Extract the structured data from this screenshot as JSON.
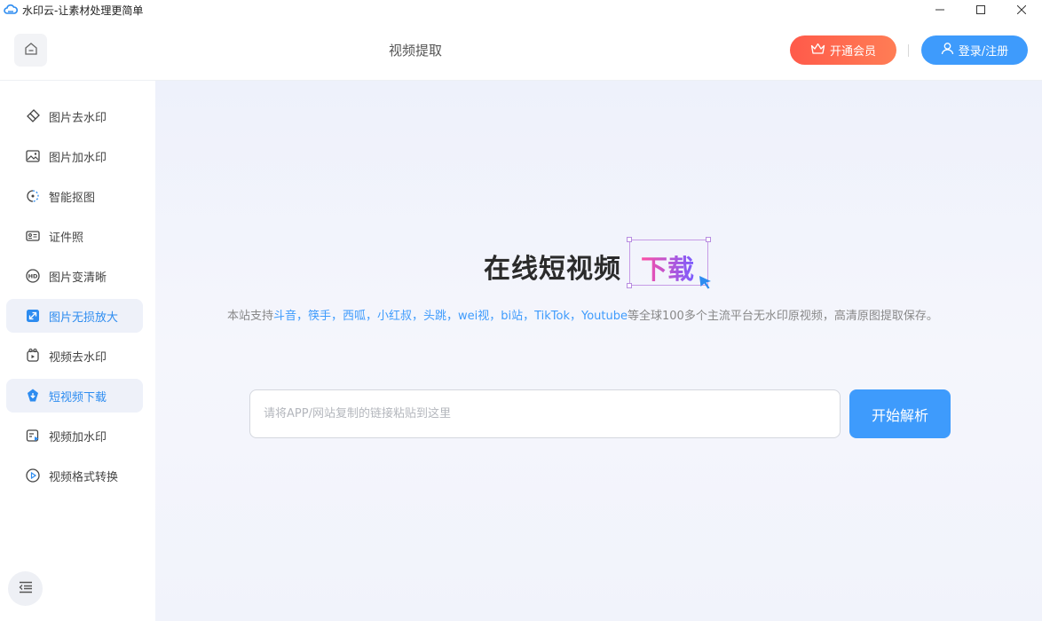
{
  "window": {
    "title": "水印云-让素材处理更简单",
    "controls": {
      "minimize": "—",
      "maximize": "☐",
      "close": "✕"
    }
  },
  "header": {
    "title": "视频提取",
    "vip_label": "开通会员",
    "login_label": "登录/注册"
  },
  "sidebar": {
    "items": [
      {
        "label": "图片去水印",
        "icon": "eraser-icon",
        "active": false
      },
      {
        "label": "图片加水印",
        "icon": "image-icon",
        "active": false
      },
      {
        "label": "智能抠图",
        "icon": "cutout-icon",
        "active": false
      },
      {
        "label": "证件照",
        "icon": "id-card-icon",
        "active": false
      },
      {
        "label": "图片变清晰",
        "icon": "hd-icon",
        "active": false
      },
      {
        "label": "图片无损放大",
        "icon": "enlarge-icon",
        "active": true
      },
      {
        "label": "视频去水印",
        "icon": "video-eraser-icon",
        "active": false
      },
      {
        "label": "短视频下载",
        "icon": "download-icon",
        "active": true
      },
      {
        "label": "视频加水印",
        "icon": "video-watermark-icon",
        "active": false
      },
      {
        "label": "视频格式转换",
        "icon": "video-convert-icon",
        "active": false
      }
    ]
  },
  "hero": {
    "title_main": "在线短视频",
    "title_highlight": "下载",
    "subtitle_prefix": "本站支持",
    "subtitle_platforms": "斗音，筷手，西呱，小红叔，头跳，wei视，bi站，TikTok，Youtube",
    "subtitle_suffix": "等全球100多个主流平台无水印原视频，高清原图提取保存。"
  },
  "input": {
    "value": "",
    "placeholder": "请将APP/网站复制的链接粘贴到这里"
  },
  "parse_button": {
    "label": "开始解析"
  },
  "colors": {
    "accent": "#3e9bfc",
    "vip_start": "#ff5a4a",
    "vip_end": "#ff7d55",
    "highlight_start": "#ff4fa3",
    "highlight_end": "#7a5cff"
  }
}
